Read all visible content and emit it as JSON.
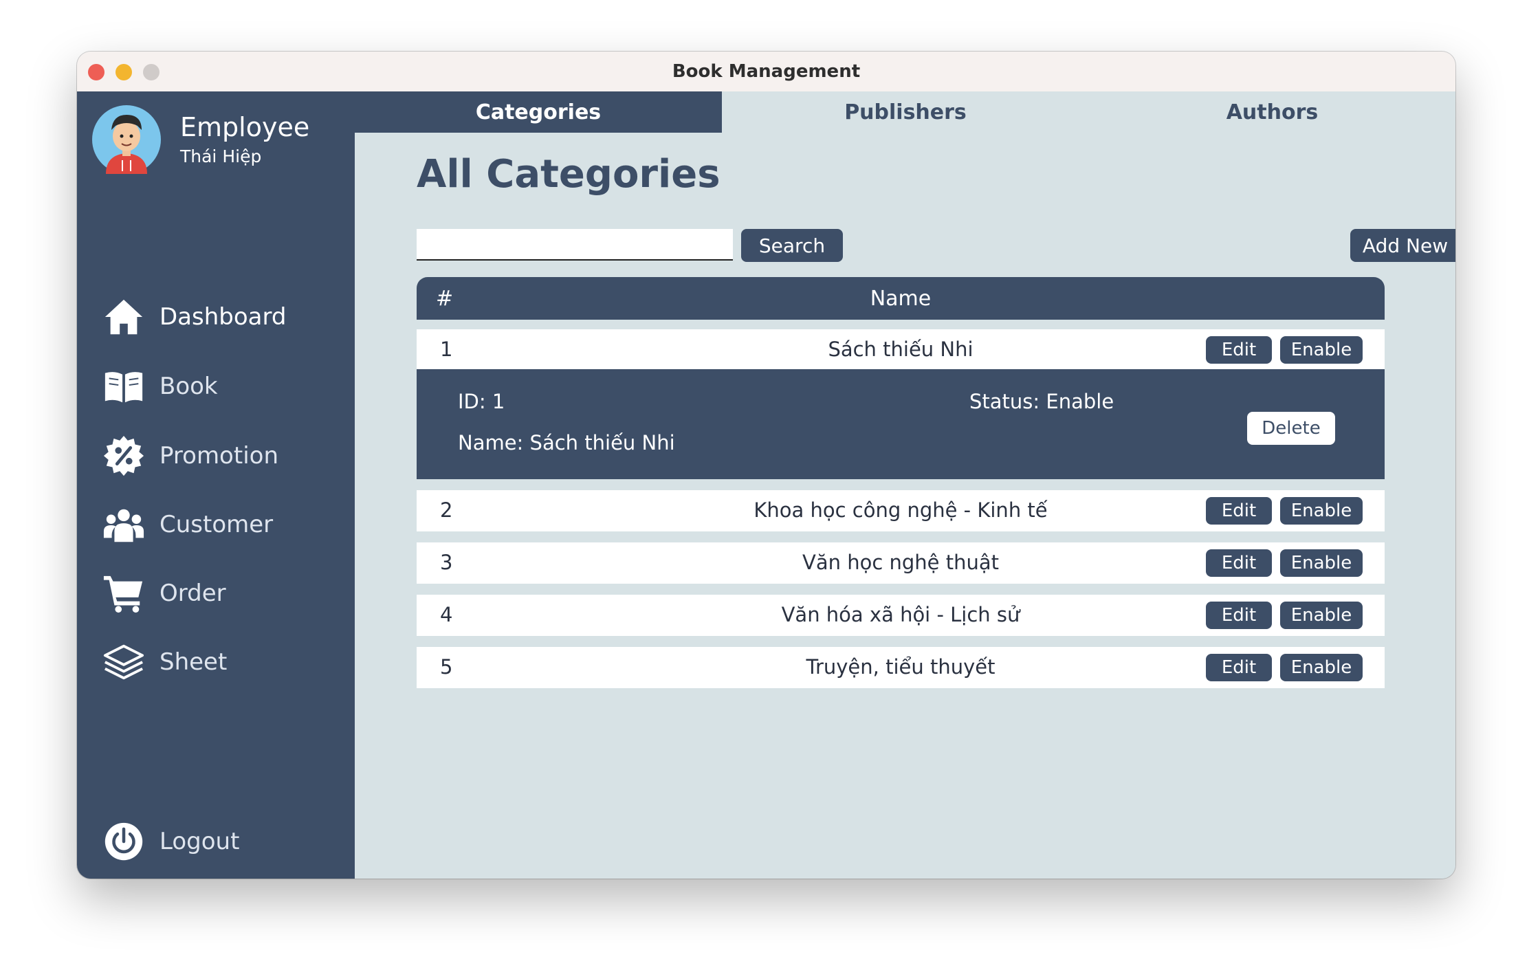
{
  "window": {
    "title": "Book Management"
  },
  "user": {
    "role": "Employee",
    "name": "Thái Hiệp"
  },
  "sidebar": {
    "items": [
      {
        "label": "Dashboard",
        "icon": "home-icon"
      },
      {
        "label": "Book",
        "icon": "book-icon"
      },
      {
        "label": "Promotion",
        "icon": "percent-badge-icon"
      },
      {
        "label": "Customer",
        "icon": "users-icon"
      },
      {
        "label": "Order",
        "icon": "cart-icon"
      },
      {
        "label": "Sheet",
        "icon": "layers-icon"
      }
    ],
    "logout": {
      "label": "Logout",
      "icon": "power-icon"
    }
  },
  "tabs": [
    {
      "label": "Categories",
      "active": true
    },
    {
      "label": "Publishers",
      "active": false
    },
    {
      "label": "Authors",
      "active": false
    }
  ],
  "page": {
    "title": "All Categories"
  },
  "search": {
    "value": "",
    "placeholder": "",
    "button_label": "Search"
  },
  "add_new_label": "Add New",
  "table": {
    "headers": {
      "num": "#",
      "name": "Name"
    },
    "rows": [
      {
        "num": "1",
        "name": "Sách thiếu Nhi",
        "edit": "Edit",
        "enable": "Enable"
      },
      {
        "num": "2",
        "name": "Khoa học công nghệ - Kinh tế",
        "edit": "Edit",
        "enable": "Enable"
      },
      {
        "num": "3",
        "name": "Văn học nghệ thuật",
        "edit": "Edit",
        "enable": "Enable"
      },
      {
        "num": "4",
        "name": "Văn hóa xã hội - Lịch sử",
        "edit": "Edit",
        "enable": "Enable"
      },
      {
        "num": "5",
        "name": "Truyện, tiểu thuyết",
        "edit": "Edit",
        "enable": "Enable"
      }
    ]
  },
  "detail": {
    "id_text": "ID: 1",
    "name_text": "Name: Sách thiếu Nhi",
    "status_text": "Status: Enable",
    "delete_label": "Delete"
  },
  "colors": {
    "primary": "#3d4e67",
    "background": "#d7e2e5",
    "row": "#ffffff"
  }
}
